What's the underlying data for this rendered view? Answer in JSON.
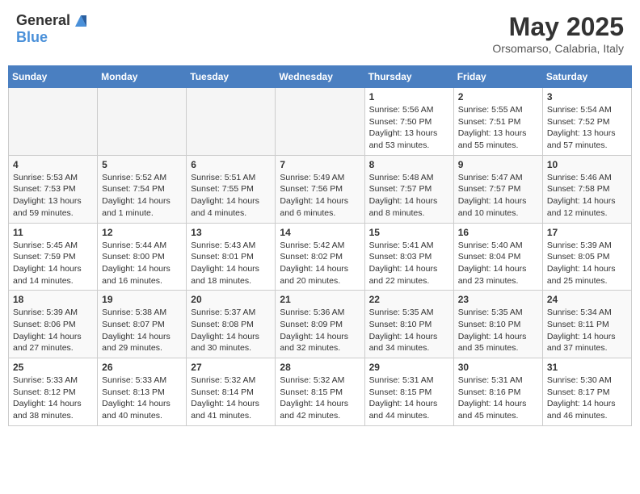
{
  "header": {
    "logo_general": "General",
    "logo_blue": "Blue",
    "month": "May 2025",
    "location": "Orsomarso, Calabria, Italy"
  },
  "weekdays": [
    "Sunday",
    "Monday",
    "Tuesday",
    "Wednesday",
    "Thursday",
    "Friday",
    "Saturday"
  ],
  "weeks": [
    [
      {
        "day": "",
        "empty": true
      },
      {
        "day": "",
        "empty": true
      },
      {
        "day": "",
        "empty": true
      },
      {
        "day": "",
        "empty": true
      },
      {
        "day": "1",
        "sunrise": "5:56 AM",
        "sunset": "7:50 PM",
        "daylight": "13 hours and 53 minutes."
      },
      {
        "day": "2",
        "sunrise": "5:55 AM",
        "sunset": "7:51 PM",
        "daylight": "13 hours and 55 minutes."
      },
      {
        "day": "3",
        "sunrise": "5:54 AM",
        "sunset": "7:52 PM",
        "daylight": "13 hours and 57 minutes."
      }
    ],
    [
      {
        "day": "4",
        "sunrise": "5:53 AM",
        "sunset": "7:53 PM",
        "daylight": "13 hours and 59 minutes."
      },
      {
        "day": "5",
        "sunrise": "5:52 AM",
        "sunset": "7:54 PM",
        "daylight": "14 hours and 1 minute."
      },
      {
        "day": "6",
        "sunrise": "5:51 AM",
        "sunset": "7:55 PM",
        "daylight": "14 hours and 4 minutes."
      },
      {
        "day": "7",
        "sunrise": "5:49 AM",
        "sunset": "7:56 PM",
        "daylight": "14 hours and 6 minutes."
      },
      {
        "day": "8",
        "sunrise": "5:48 AM",
        "sunset": "7:57 PM",
        "daylight": "14 hours and 8 minutes."
      },
      {
        "day": "9",
        "sunrise": "5:47 AM",
        "sunset": "7:57 PM",
        "daylight": "14 hours and 10 minutes."
      },
      {
        "day": "10",
        "sunrise": "5:46 AM",
        "sunset": "7:58 PM",
        "daylight": "14 hours and 12 minutes."
      }
    ],
    [
      {
        "day": "11",
        "sunrise": "5:45 AM",
        "sunset": "7:59 PM",
        "daylight": "14 hours and 14 minutes."
      },
      {
        "day": "12",
        "sunrise": "5:44 AM",
        "sunset": "8:00 PM",
        "daylight": "14 hours and 16 minutes."
      },
      {
        "day": "13",
        "sunrise": "5:43 AM",
        "sunset": "8:01 PM",
        "daylight": "14 hours and 18 minutes."
      },
      {
        "day": "14",
        "sunrise": "5:42 AM",
        "sunset": "8:02 PM",
        "daylight": "14 hours and 20 minutes."
      },
      {
        "day": "15",
        "sunrise": "5:41 AM",
        "sunset": "8:03 PM",
        "daylight": "14 hours and 22 minutes."
      },
      {
        "day": "16",
        "sunrise": "5:40 AM",
        "sunset": "8:04 PM",
        "daylight": "14 hours and 23 minutes."
      },
      {
        "day": "17",
        "sunrise": "5:39 AM",
        "sunset": "8:05 PM",
        "daylight": "14 hours and 25 minutes."
      }
    ],
    [
      {
        "day": "18",
        "sunrise": "5:39 AM",
        "sunset": "8:06 PM",
        "daylight": "14 hours and 27 minutes."
      },
      {
        "day": "19",
        "sunrise": "5:38 AM",
        "sunset": "8:07 PM",
        "daylight": "14 hours and 29 minutes."
      },
      {
        "day": "20",
        "sunrise": "5:37 AM",
        "sunset": "8:08 PM",
        "daylight": "14 hours and 30 minutes."
      },
      {
        "day": "21",
        "sunrise": "5:36 AM",
        "sunset": "8:09 PM",
        "daylight": "14 hours and 32 minutes."
      },
      {
        "day": "22",
        "sunrise": "5:35 AM",
        "sunset": "8:10 PM",
        "daylight": "14 hours and 34 minutes."
      },
      {
        "day": "23",
        "sunrise": "5:35 AM",
        "sunset": "8:10 PM",
        "daylight": "14 hours and 35 minutes."
      },
      {
        "day": "24",
        "sunrise": "5:34 AM",
        "sunset": "8:11 PM",
        "daylight": "14 hours and 37 minutes."
      }
    ],
    [
      {
        "day": "25",
        "sunrise": "5:33 AM",
        "sunset": "8:12 PM",
        "daylight": "14 hours and 38 minutes."
      },
      {
        "day": "26",
        "sunrise": "5:33 AM",
        "sunset": "8:13 PM",
        "daylight": "14 hours and 40 minutes."
      },
      {
        "day": "27",
        "sunrise": "5:32 AM",
        "sunset": "8:14 PM",
        "daylight": "14 hours and 41 minutes."
      },
      {
        "day": "28",
        "sunrise": "5:32 AM",
        "sunset": "8:15 PM",
        "daylight": "14 hours and 42 minutes."
      },
      {
        "day": "29",
        "sunrise": "5:31 AM",
        "sunset": "8:15 PM",
        "daylight": "14 hours and 44 minutes."
      },
      {
        "day": "30",
        "sunrise": "5:31 AM",
        "sunset": "8:16 PM",
        "daylight": "14 hours and 45 minutes."
      },
      {
        "day": "31",
        "sunrise": "5:30 AM",
        "sunset": "8:17 PM",
        "daylight": "14 hours and 46 minutes."
      }
    ]
  ],
  "labels": {
    "sunrise": "Sunrise:",
    "sunset": "Sunset:",
    "daylight": "Daylight hours"
  }
}
